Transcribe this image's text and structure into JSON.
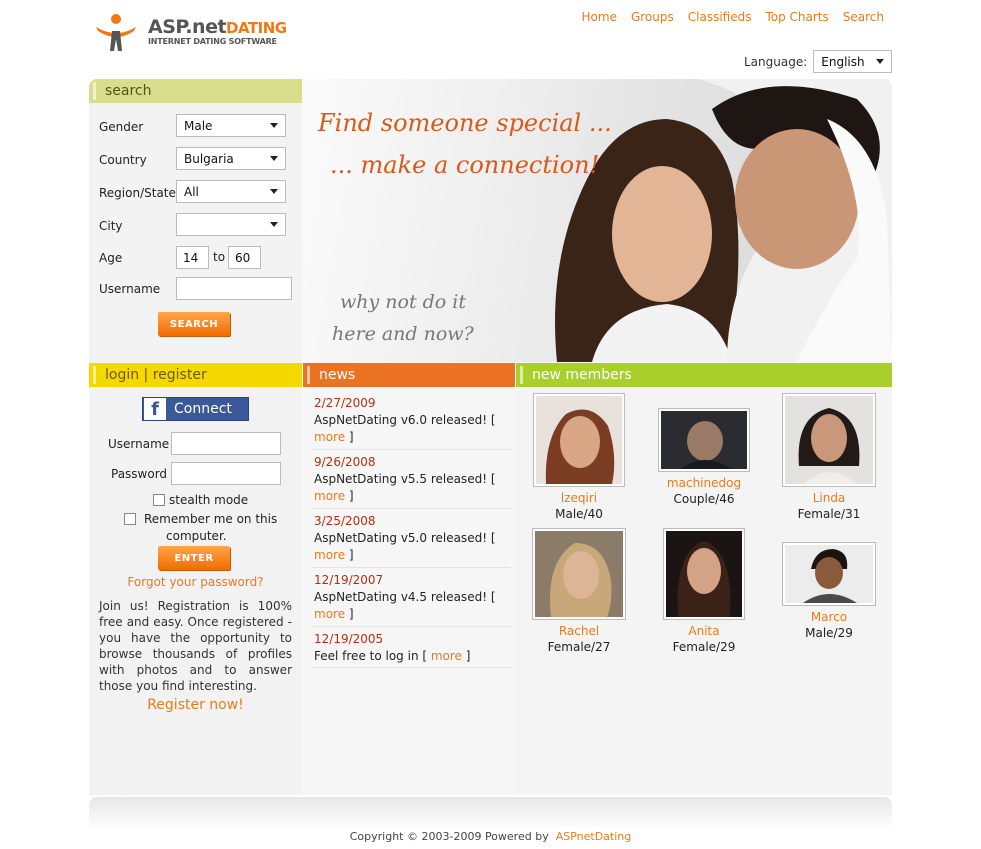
{
  "header": {
    "logo_main": "ASP.net",
    "logo_accent": "DATING",
    "logo_tagline": "INTERNET DATING SOFTWARE",
    "nav": [
      "Home",
      "Groups",
      "Classifieds",
      "Top Charts",
      "Search"
    ],
    "language_label": "Language:",
    "language_value": "English"
  },
  "search": {
    "title": "search",
    "gender_label": "Gender",
    "gender_value": "Male",
    "country_label": "Country",
    "country_value": "Bulgaria",
    "region_label": "Region/State",
    "region_value": "All",
    "city_label": "City",
    "city_value": "",
    "age_label": "Age",
    "age_from": "14",
    "age_to_label": "to",
    "age_to": "60",
    "username_label": "Username",
    "username_value": "",
    "button": "SEARCH"
  },
  "hero": {
    "line1": "Find someone special ...",
    "line2": "... make a connection!",
    "sub1": "why not do it",
    "sub2": "here and now?"
  },
  "login": {
    "title": "login | register",
    "fb_connect": "Connect",
    "username_label": "Username",
    "password_label": "Password",
    "stealth_label": "stealth mode",
    "remember_label_1": "Remember me on this",
    "remember_label_2": "computer.",
    "enter_button": "ENTER",
    "forgot_link": "Forgot your password?",
    "join_text": "Join us! Registration is 100% free and easy. Once registered - you have the opportunity to browse thousands of profiles with photos and to answer those you find interesting.",
    "register_link": "Register now!"
  },
  "news": {
    "title": "news",
    "items": [
      {
        "date": "2/27/2009",
        "text": "AspNetDating v6.0 released!",
        "more": "more"
      },
      {
        "date": "9/26/2008",
        "text": "AspNetDating v5.5 released!",
        "more": "more"
      },
      {
        "date": "3/25/2008",
        "text": "AspNetDating v5.0 released!",
        "more": "more"
      },
      {
        "date": "12/19/2007",
        "text": "AspNetDating v4.5 released!",
        "more": "more"
      },
      {
        "date": "12/19/2005",
        "text": "Feel free to log in",
        "more": "more"
      }
    ]
  },
  "members": {
    "title": "new members",
    "list": [
      {
        "name": "lzeqiri",
        "info": "Male/40",
        "color": "#b0674a"
      },
      {
        "name": "machinedog",
        "info": "Couple/46",
        "color": "#3a4048"
      },
      {
        "name": "Linda",
        "info": "Female/31",
        "color": "#6b5548"
      },
      {
        "name": "Rachel",
        "info": "Female/27",
        "color": "#8a7458"
      },
      {
        "name": "Anita",
        "info": "Female/29",
        "color": "#5a3a2c"
      },
      {
        "name": "Marco",
        "info": "Male/29",
        "color": "#4a3428"
      }
    ]
  },
  "footer": {
    "copyright": "Copyright © 2003-2009 Powered by",
    "powered_link": "ASPnetDating"
  }
}
